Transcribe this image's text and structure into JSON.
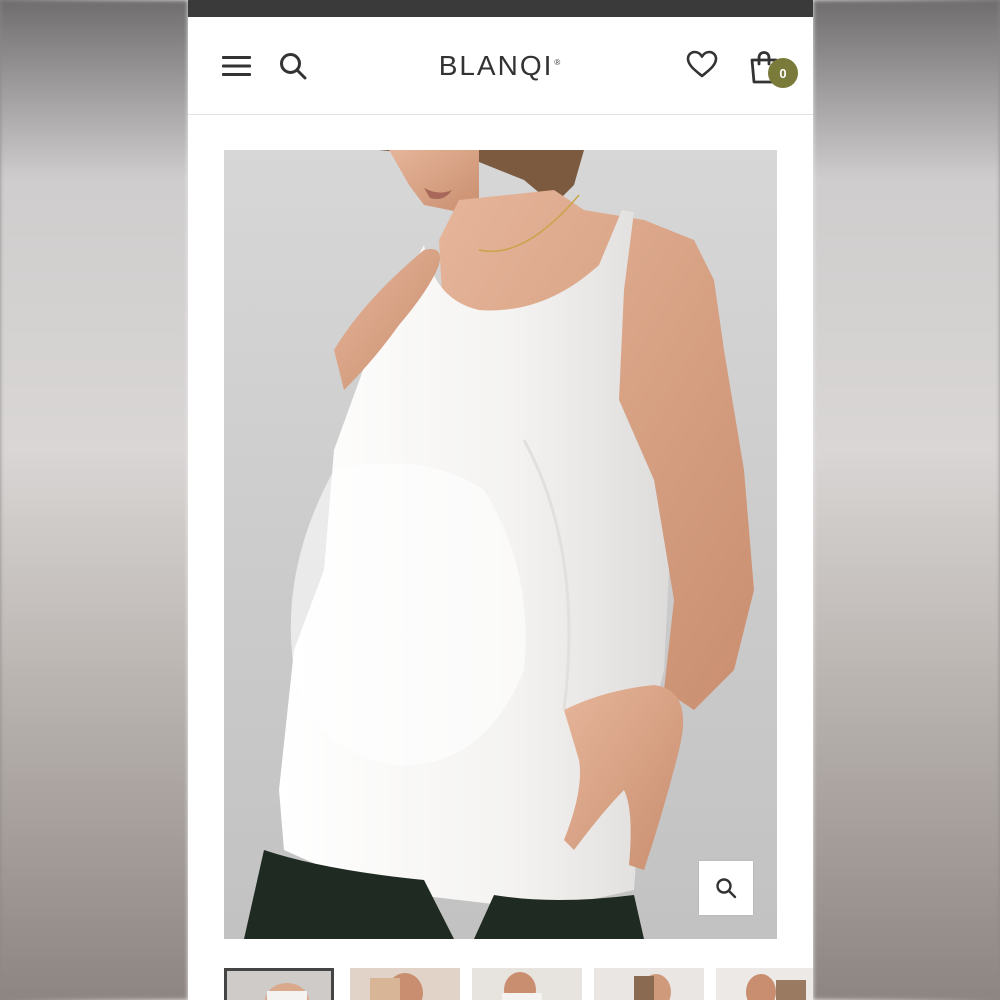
{
  "brand": {
    "logo_text": "BLANQI",
    "registered_mark": "®"
  },
  "header": {
    "cart_count": "0"
  },
  "icons": {
    "menu": "hamburger-menu-icon",
    "search": "search-icon",
    "wishlist": "heart-icon",
    "cart": "shopping-bag-icon",
    "zoom": "magnifier-zoom-icon"
  },
  "colors": {
    "status_bar": "#3a3a3a",
    "badge": "#7a7a3a",
    "text": "#333333",
    "image_background": "#cdcdcd",
    "top_garment": "#f4f3f1",
    "leggings": "#1f2a22"
  },
  "gallery": {
    "thumbnail_count": 5,
    "active_index": 0
  }
}
